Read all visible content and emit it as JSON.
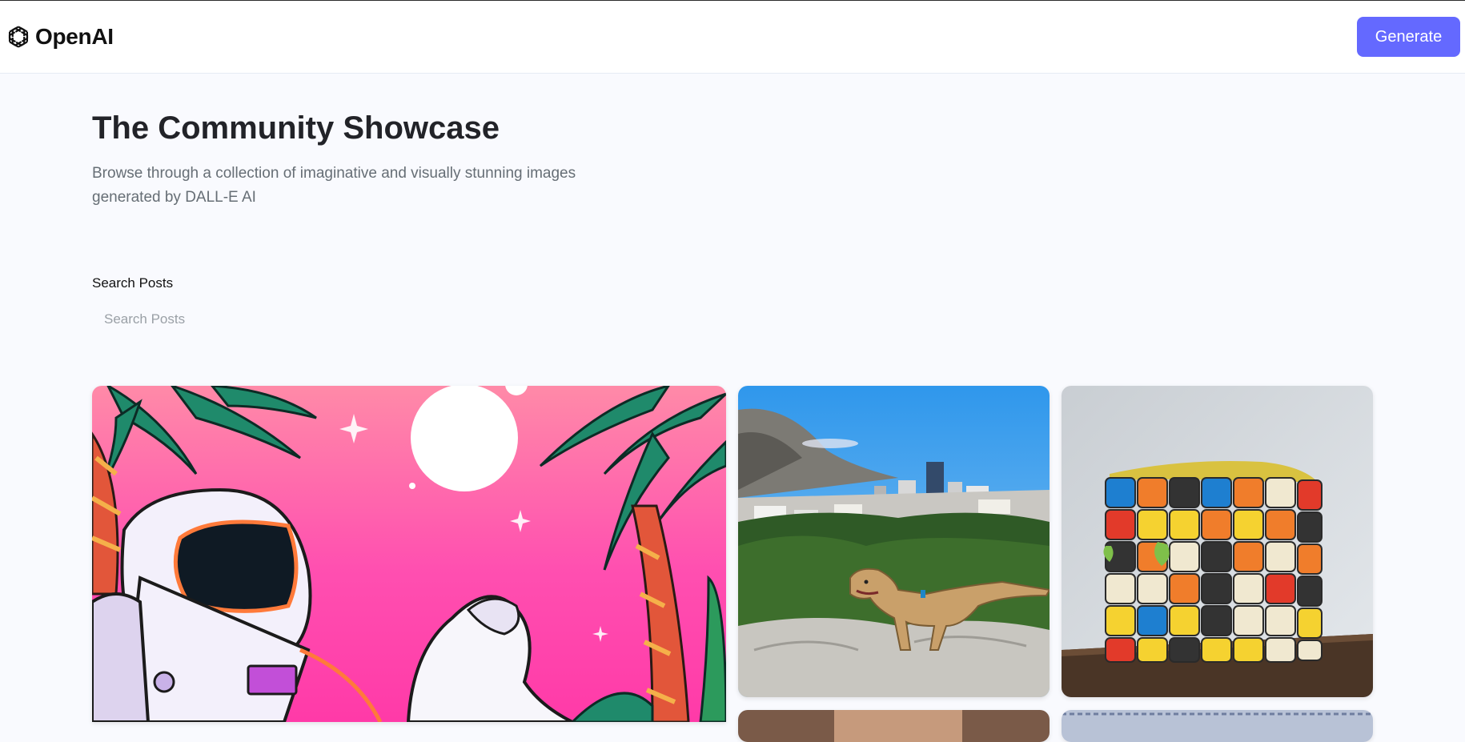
{
  "header": {
    "brand_name": "OpenAI",
    "generate_label": "Generate"
  },
  "main": {
    "title": "The Community Showcase",
    "subtitle": "Browse through a collection of imaginative and visually stunning images generated by DALL-E AI",
    "search": {
      "label": "Search Posts",
      "placeholder": "Search Posts",
      "value": ""
    }
  },
  "gallery": {
    "cards": [
      {
        "icon": "astronaut-palm-trees-image"
      },
      {
        "icon": "dinosaur-city-image"
      },
      {
        "icon": "rubiks-cube-cake-image"
      },
      {
        "icon": "partial-image"
      },
      {
        "icon": "partial-image"
      }
    ]
  },
  "colors": {
    "accent": "#6469ff",
    "page_background": "#f9fafe",
    "title_color": "#222328",
    "subtitle_color": "#666e75"
  }
}
